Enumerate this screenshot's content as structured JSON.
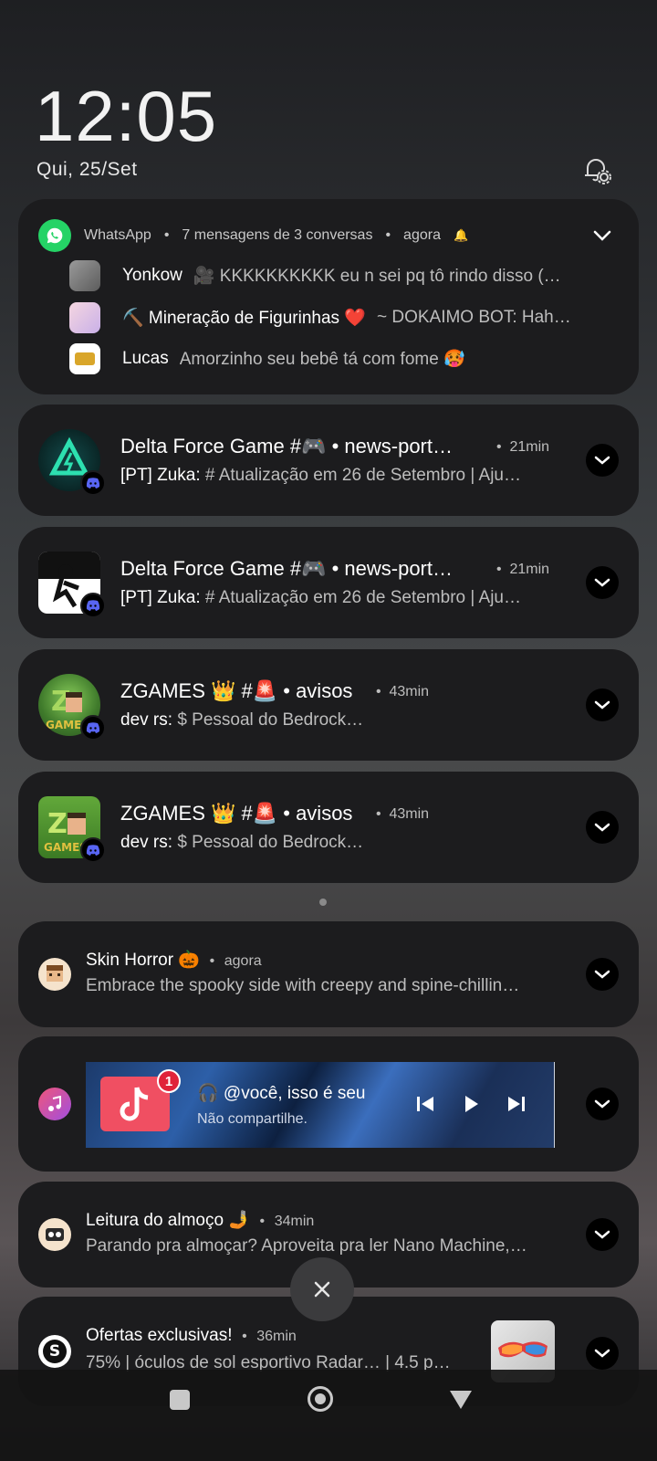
{
  "status": {
    "time": "12:05",
    "date": "Qui, 25/Set"
  },
  "whatsapp": {
    "app": "WhatsApp",
    "summary": "7 mensagens de 3 conversas",
    "time": "agora",
    "rows": [
      {
        "name": "Yonkow",
        "message": "🎥 KKKKKKKKKK eu n sei pq tô rindo disso (…"
      },
      {
        "name": "⛏️ Mineração de Figurinhas ❤️",
        "message": "~ DOKAIMO BOT: Hah…"
      },
      {
        "name": "Lucas",
        "message": "Amorzinho seu bebê tá com fome 🥵"
      }
    ]
  },
  "discord": [
    {
      "title": "Delta Force Game #🎮 • news-port…",
      "time": "21min",
      "sender": "[PT] Zuka:",
      "text": "# Atualização em 26 de Setembro | Aju…"
    },
    {
      "title": "Delta Force Game #🎮 • news-port…",
      "time": "21min",
      "sender": "[PT] Zuka:",
      "text": "# Atualização em 26 de Setembro | Aju…"
    },
    {
      "title": "ZGAMES 👑 #🚨 • avisos",
      "time": "43min",
      "sender": "dev rs:",
      "text": "$ Pessoal do Bedrock…"
    },
    {
      "title": "ZGAMES 👑 #🚨 • avisos",
      "time": "43min",
      "sender": "dev rs:",
      "text": "$ Pessoal do Bedrock…"
    }
  ],
  "skin": {
    "title": "Skin Horror 🎃",
    "time": "agora",
    "text": "Embrace the spooky side with creepy and spine-chillin…"
  },
  "media": {
    "badge": "1",
    "title": "🎧 @você, isso é seu",
    "subtitle": "Não compartilhe."
  },
  "reading": {
    "title": "Leitura do almoço 🤳",
    "time": "34min",
    "text": "Parando pra almoçar? Aproveita pra ler Nano Machine,…"
  },
  "offers": {
    "title": "Ofertas exclusivas!",
    "time": "36min",
    "text": "75% | óculos de sol esportivo Radar… | 4.5 p…"
  },
  "separator": "•",
  "colors": {
    "card": "#1c1c1e",
    "whatsapp": "#25d366",
    "tiktok": "#f04f62"
  }
}
